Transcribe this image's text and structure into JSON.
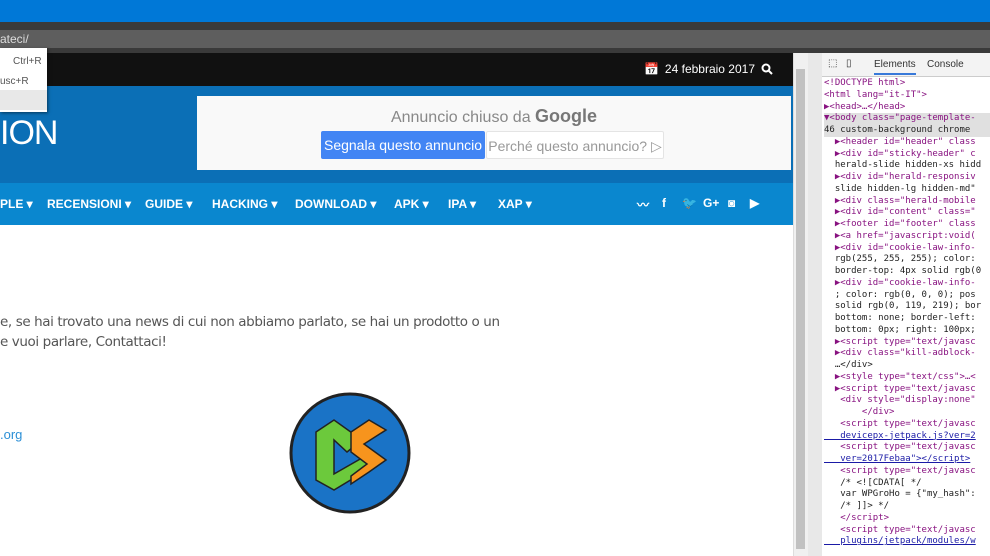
{
  "browser": {
    "address": "ateci/"
  },
  "context_menu": {
    "items": [
      {
        "shortcut": "Ctrl+R"
      },
      {
        "shortcut": "usc+R"
      },
      {
        "shortcut": ""
      }
    ]
  },
  "site": {
    "date": "24 febbraio 2017",
    "logo_text": "ION",
    "ad": {
      "title_prefix": "Annuncio chiuso da",
      "title_brand": "Google",
      "report_label": "Segnala questo annuncio",
      "why_label": "Perché questo annuncio?",
      "why_icon": "▷"
    },
    "nav": [
      {
        "label": "PLE ▾"
      },
      {
        "label": "RECENSIONI ▾"
      },
      {
        "label": "GUIDE ▾"
      },
      {
        "label": "HACKING ▾"
      },
      {
        "label": "DOWNLOAD ▾"
      },
      {
        "label": "APK ▾"
      },
      {
        "label": "IPA ▾"
      },
      {
        "label": "XAP ▾"
      }
    ],
    "social": [
      "rss-icon",
      "facebook-icon",
      "twitter-icon",
      "google-plus-icon",
      "instagram-icon",
      "youtube-icon"
    ],
    "content": {
      "line1": "e, se hai trovato una news di cui non abbiamo parlato, se hai un prodotto o un",
      "line2": "e vuoi parlare, Contattaci!",
      "link": ".org"
    }
  },
  "devtools": {
    "tabs": [
      {
        "label": "Elements"
      },
      {
        "label": "Console"
      }
    ],
    "lines": [
      {
        "t": "<!DOCTYPE html>"
      },
      {
        "t": "<html lang=\"it-IT\">"
      },
      {
        "t": "▶<head>…</head>"
      },
      {
        "t": "▼<body class=\"page-template-",
        "sel": true
      },
      {
        "t": "46 custom-background chrome ",
        "sel": true
      },
      {
        "t": "  ▶<header id=\"header\" class"
      },
      {
        "t": "  ▶<div id=\"sticky-header\" c"
      },
      {
        "t": "  herald-slide hidden-xs hidd"
      },
      {
        "t": "  ▶<div id=\"herald-responsiv"
      },
      {
        "t": "  slide hidden-lg hidden-md\""
      },
      {
        "t": "  ▶<div class=\"herald-mobile"
      },
      {
        "t": "  ▶<div id=\"content\" class=\""
      },
      {
        "t": "  ▶<footer id=\"footer\" class"
      },
      {
        "t": "  ▶<a href=\"javascript:void("
      },
      {
        "t": "  ▶<div id=\"cookie-law-info-"
      },
      {
        "t": "  rgb(255, 255, 255); color:"
      },
      {
        "t": "  border-top: 4px solid rgb(0"
      },
      {
        "t": "  ▶<div id=\"cookie-law-info-"
      },
      {
        "t": "  ; color: rgb(0, 0, 0); pos"
      },
      {
        "t": "  solid rgb(0, 119, 219); bor"
      },
      {
        "t": "  bottom: none; border-left:"
      },
      {
        "t": "  bottom: 0px; right: 100px;"
      },
      {
        "t": "  ▶<script type=\"text/javasc"
      },
      {
        "t": "  ▶<div class=\"kill-adblock-"
      },
      {
        "t": "  …</div>"
      },
      {
        "t": "  ▶<style type=\"text/css\">…<"
      },
      {
        "t": "  ▶<script type=\"text/javasc"
      },
      {
        "t": "   <div style=\"display:none\""
      },
      {
        "t": "       </div>"
      },
      {
        "t": "   <script type=\"text/javasc"
      },
      {
        "t": "   devicepx-jetpack.js?ver=2",
        "link": true
      },
      {
        "t": "   <script type=\"text/javasc"
      },
      {
        "t": "   ver=2017Febaa\"></script>",
        "link": true
      },
      {
        "t": "   <script type=\"text/javasc"
      },
      {
        "t": "   /* <![CDATA[ */"
      },
      {
        "t": "   var WPGroHo = {\"my_hash\":"
      },
      {
        "t": "   /* ]]> */"
      },
      {
        "t": "   </script>"
      },
      {
        "t": "   <script type=\"text/javasc"
      },
      {
        "t": "   plugins/jetpack/modules/w",
        "link": true
      }
    ]
  }
}
